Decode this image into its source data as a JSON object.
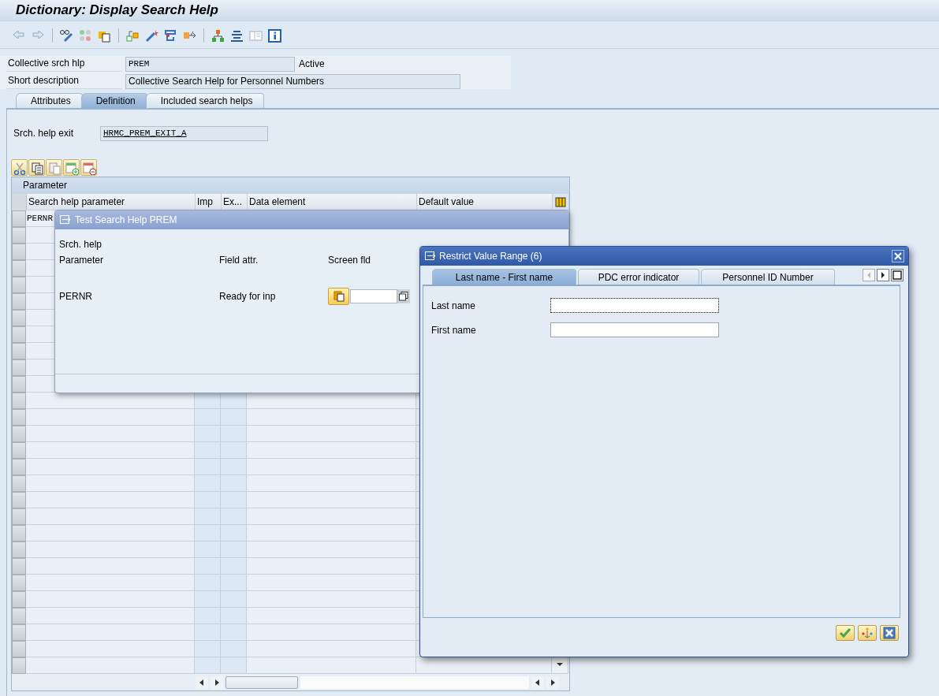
{
  "window": {
    "title": "Dictionary: Display Search Help"
  },
  "header_fields": [
    {
      "label": "Collective srch hlp",
      "value": "PREM",
      "status": "Active"
    },
    {
      "label": "Short description",
      "value": "Collective Search Help for Personnel Numbers"
    }
  ],
  "tabs": [
    {
      "label": "Attributes",
      "selected": false
    },
    {
      "label": "Definition",
      "selected": true
    },
    {
      "label": "Included search helps",
      "selected": false
    }
  ],
  "exit_field": {
    "label": "Srch. help exit",
    "value": "HRMC_PREM_EXIT_A"
  },
  "table": {
    "caption": "Parameter",
    "columns": [
      "Search help parameter",
      "Imp",
      "Ex...",
      "Data element",
      "Default value"
    ],
    "rows": [
      [
        "PERNR"
      ]
    ]
  },
  "test_dialog": {
    "title": "Test Search Help PREM",
    "label": "Srch. help",
    "columns": [
      "Parameter",
      "Field attr.",
      "Screen fld"
    ],
    "row": {
      "parameter": "PERNR",
      "attribute": "Ready for inp"
    }
  },
  "restrict_dialog": {
    "title": "Restrict Value Range (6)",
    "tabs": [
      {
        "label": "Last name - First name",
        "selected": true
      },
      {
        "label": "PDC error indicator",
        "selected": false
      },
      {
        "label": "Personnel ID Number",
        "selected": false
      }
    ],
    "fields": [
      {
        "label": "Last name",
        "focused": true
      },
      {
        "label": "First name",
        "focused": false
      }
    ]
  }
}
